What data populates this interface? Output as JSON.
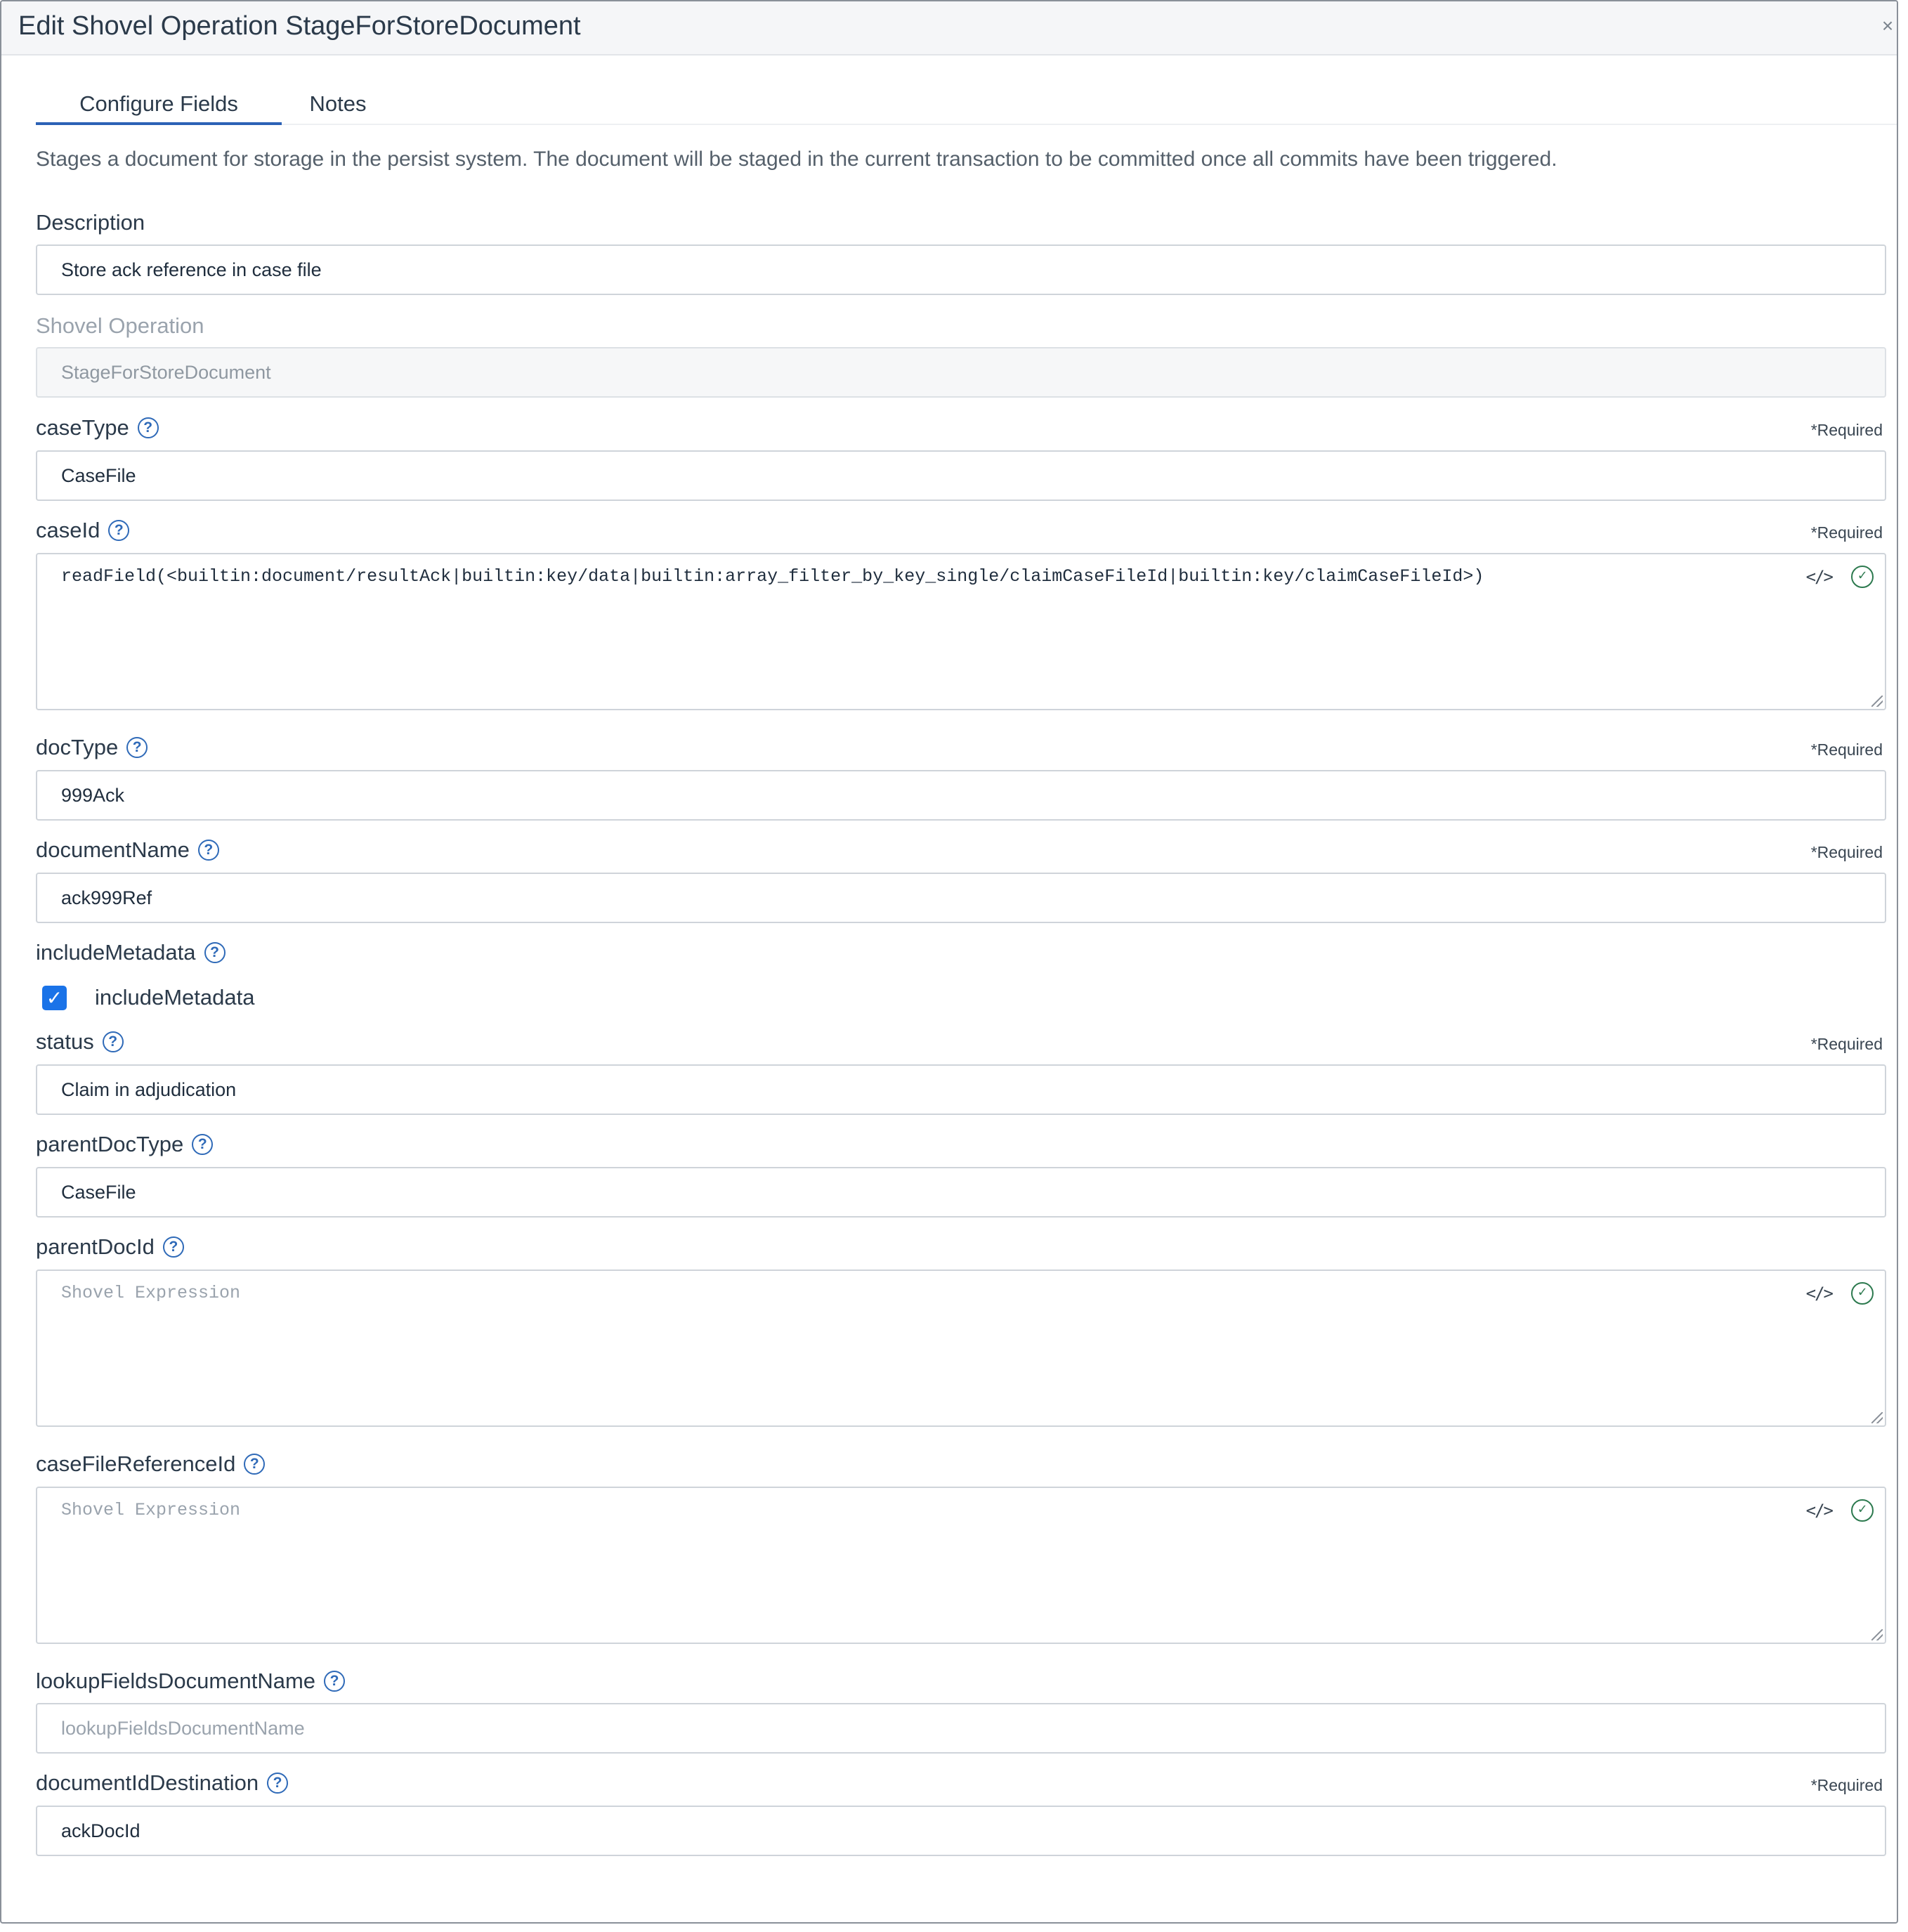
{
  "modal": {
    "title": "Edit Shovel Operation StageForStoreDocument",
    "close_symbol": "×"
  },
  "tabs": [
    {
      "label": "Configure Fields",
      "active": true
    },
    {
      "label": "Notes",
      "active": false
    }
  ],
  "intro_text": "Stages a document for storage in the persist system. The document will be staged in the current transaction to be committed once all commits have been triggered.",
  "required_text": "*Required",
  "help_symbol": "?",
  "code_symbol": "</>",
  "check_symbol": "✓",
  "fields": {
    "description": {
      "label": "Description",
      "value": "Store ack reference in case file"
    },
    "shovel_operation": {
      "label": "Shovel Operation",
      "value": "StageForStoreDocument"
    },
    "case_type": {
      "label": "caseType",
      "value": "CaseFile"
    },
    "case_id": {
      "label": "caseId",
      "value": "readField(<builtin:document/resultAck|builtin:key/data|builtin:array_filter_by_key_single/claimCaseFileId|builtin:key/claimCaseFileId>)"
    },
    "doc_type": {
      "label": "docType",
      "value": "999Ack"
    },
    "document_name": {
      "label": "documentName",
      "value": "ack999Ref"
    },
    "include_metadata": {
      "label": "includeMetadata",
      "checkbox_label": "includeMetadata",
      "checked": true
    },
    "status": {
      "label": "status",
      "value": "Claim in adjudication"
    },
    "parent_doc_type": {
      "label": "parentDocType",
      "value": "CaseFile"
    },
    "parent_doc_id": {
      "label": "parentDocId",
      "placeholder": "Shovel Expression"
    },
    "case_file_reference_id": {
      "label": "caseFileReferenceId",
      "placeholder": "Shovel Expression"
    },
    "lookup_fields_document_name": {
      "label": "lookupFieldsDocumentName",
      "placeholder": "lookupFieldsDocumentName"
    },
    "document_id_destination": {
      "label": "documentIdDestination",
      "value": "ackDocId"
    }
  },
  "colors": {
    "accent": "#2c62b6",
    "checkbox": "#1a73e8",
    "valid": "#2d7a4f"
  }
}
